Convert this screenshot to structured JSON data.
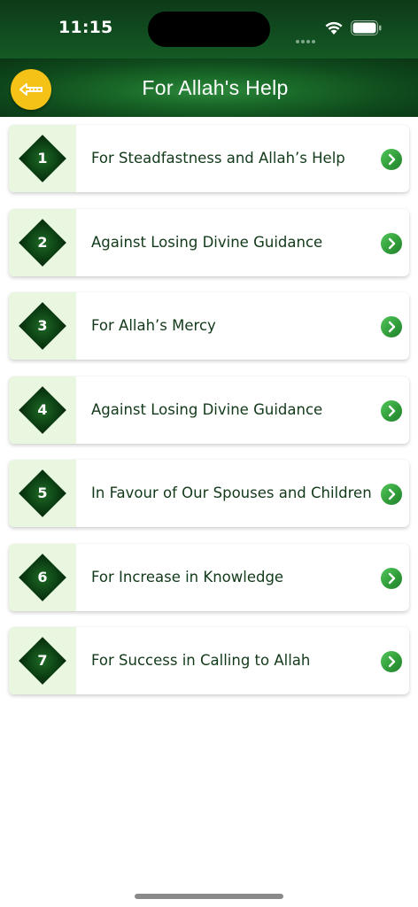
{
  "status_bar": {
    "time": "11:15"
  },
  "nav": {
    "title": "For Allah's Help",
    "back_icon": "back-arrow-icon"
  },
  "colors": {
    "nav_green": "#145a25",
    "back_button_yellow": "#f5c217",
    "number_panel_bg": "#eaf7e0",
    "diamond_green": "#0b3d12",
    "chevron_green": "#3aa843",
    "label_text": "#123a1a"
  },
  "items": [
    {
      "number": "1",
      "label": "For Steadfastness and Allah’s Help"
    },
    {
      "number": "2",
      "label": "Against Losing Divine Guidance"
    },
    {
      "number": "3",
      "label": "For Allah’s Mercy"
    },
    {
      "number": "4",
      "label": "Against Losing Divine Guidance"
    },
    {
      "number": "5",
      "label": "In Favour of Our Spouses and Children"
    },
    {
      "number": "6",
      "label": "For Increase in Knowledge"
    },
    {
      "number": "7",
      "label": "For Success in Calling to Allah"
    }
  ]
}
